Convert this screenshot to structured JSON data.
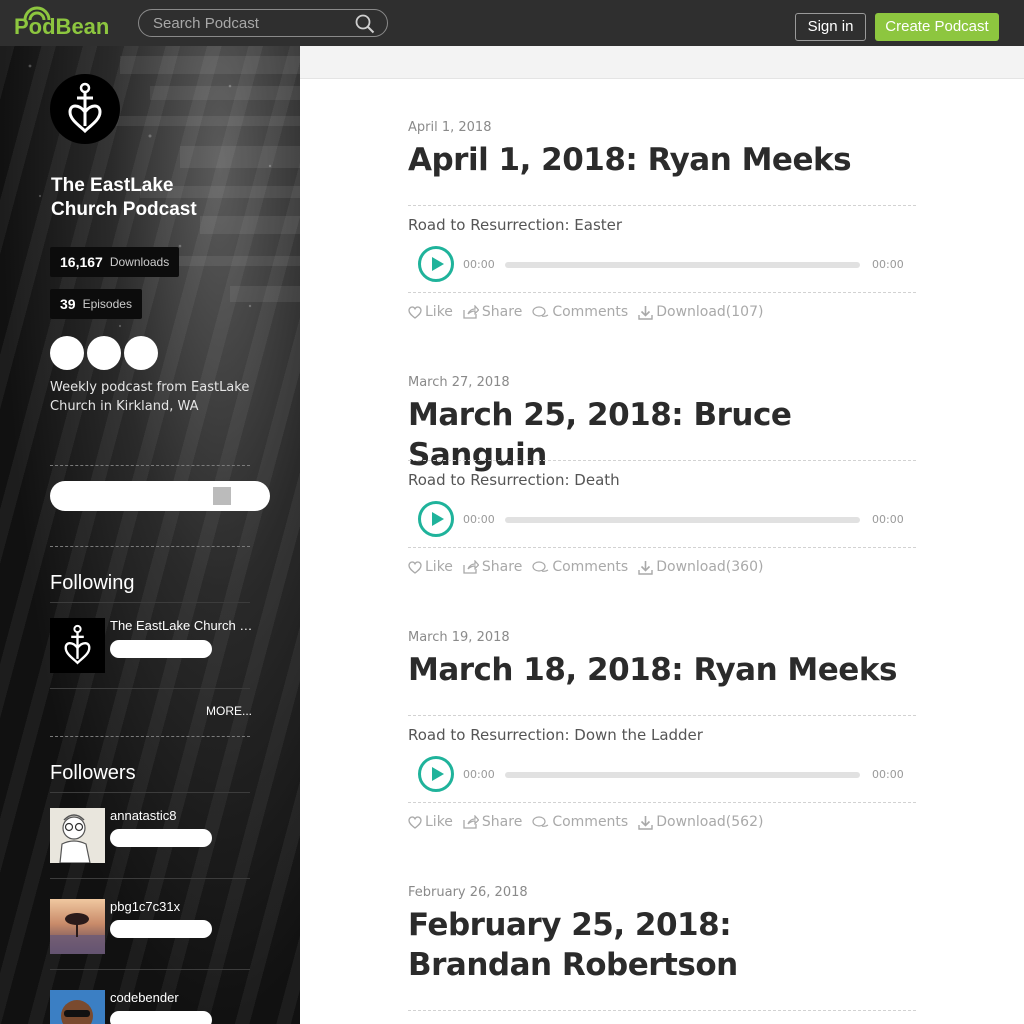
{
  "header": {
    "logo_text": "PodBean",
    "search_placeholder": "Search Podcast",
    "signin_label": "Sign in",
    "create_label": "Create Podcast",
    "brand_color": "#8dc63f"
  },
  "sidebar": {
    "podcast_title_line1": "The EastLake",
    "podcast_title_line2": "Church Podcast",
    "downloads": {
      "value": "16,167",
      "label": "Downloads"
    },
    "episodes": {
      "value": "39",
      "label": "Episodes"
    },
    "description": "Weekly podcast from EastLake Church in Kirkland, WA",
    "following_title": "Following",
    "following": [
      {
        "name": "The EastLake Church Podcast"
      }
    ],
    "more_label": "MORE...",
    "followers_title": "Followers",
    "followers": [
      {
        "name": "annatastic8"
      },
      {
        "name": "pbg1c7c31x"
      },
      {
        "name": "codebender"
      }
    ]
  },
  "episodes": [
    {
      "date": "April 1, 2018",
      "title": "April 1, 2018: Ryan Meeks",
      "subtitle": "Road to Resurrection: Easter",
      "time_start": "00:00",
      "time_end": "00:00",
      "like": "Like",
      "share": "Share",
      "comments": "Comments",
      "download": "Download(107)"
    },
    {
      "date": "March 27, 2018",
      "title": "March 25, 2018: Bruce Sanguin",
      "subtitle": "Road to Resurrection: Death",
      "time_start": "00:00",
      "time_end": "00:00",
      "like": "Like",
      "share": "Share",
      "comments": "Comments",
      "download": "Download(360)"
    },
    {
      "date": "March 19, 2018",
      "title": "March 18, 2018: Ryan Meeks",
      "subtitle": "Road to Resurrection: Down the Ladder",
      "time_start": "00:00",
      "time_end": "00:00",
      "like": "Like",
      "share": "Share",
      "comments": "Comments",
      "download": "Download(562)"
    },
    {
      "date": "February 26, 2018",
      "title": "February 25, 2018: Brandan Robertson"
    }
  ],
  "accent_color": "#1fb39b"
}
